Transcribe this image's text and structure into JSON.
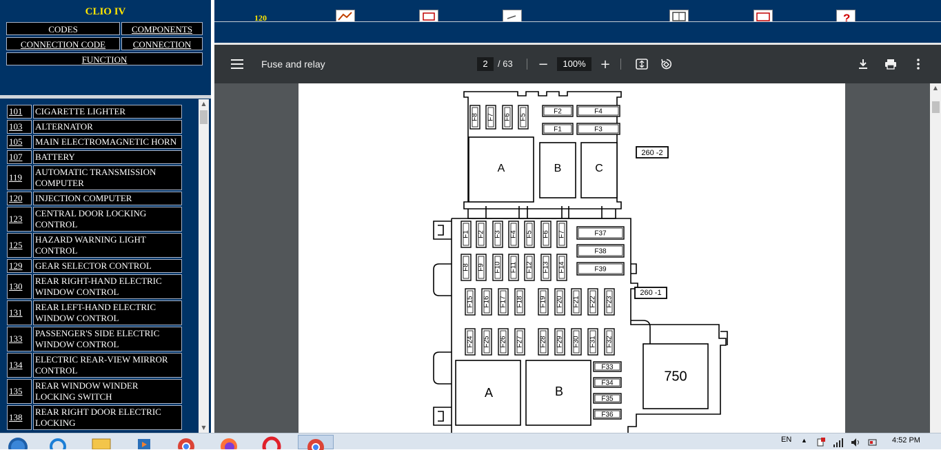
{
  "left_nav": {
    "title": "CLIO IV",
    "codes": "CODES",
    "components": "COMPONENTS",
    "connection_code": "CONNECTION CODE",
    "connection": "CONNECTION",
    "function": "FUNCTION"
  },
  "components_list": [
    {
      "num": "101",
      "name": "CIGARETTE LIGHTER"
    },
    {
      "num": "103",
      "name": "ALTERNATOR"
    },
    {
      "num": "105",
      "name": "MAIN ELECTROMAGNETIC HORN"
    },
    {
      "num": "107",
      "name": "BATTERY"
    },
    {
      "num": "119",
      "name": "AUTOMATIC TRANSMISSION COMPUTER"
    },
    {
      "num": "120",
      "name": "INJECTION COMPUTER"
    },
    {
      "num": "123",
      "name": "CENTRAL DOOR LOCKING CONTROL"
    },
    {
      "num": "125",
      "name": "HAZARD WARNING LIGHT CONTROL"
    },
    {
      "num": "129",
      "name": "GEAR SELECTOR CONTROL"
    },
    {
      "num": "130",
      "name": "REAR RIGHT-HAND ELECTRIC WINDOW CONTROL"
    },
    {
      "num": "131",
      "name": "REAR LEFT-HAND ELECTRIC WINDOW CONTROL"
    },
    {
      "num": "133",
      "name": "PASSENGER'S SIDE ELECTRIC WINDOW CONTROL"
    },
    {
      "num": "134",
      "name": "ELECTRIC REAR-VIEW MIRROR CONTROL"
    },
    {
      "num": "135",
      "name": "REAR WINDOW WINDER LOCKING SWITCH"
    },
    {
      "num": "138",
      "name": "REAR RIGHT DOOR ELECTRIC LOCKING"
    }
  ],
  "top_strip": {
    "partial_code": "120"
  },
  "pdf_toolbar": {
    "title": "Fuse and relay",
    "page_current": "2",
    "page_total": "/ 63",
    "zoom": "100%"
  },
  "diagram": {
    "upper_small_fuses": [
      "F8",
      "F7",
      "F6",
      "F5"
    ],
    "upper_wide_fuses": [
      "F2",
      "F4",
      "F1",
      "F3"
    ],
    "upper_relays": [
      "A",
      "B",
      "C"
    ],
    "label_top": "260 -2",
    "label_mid": "260 -1",
    "row1_fuses": [
      "F1",
      "F2",
      "F3",
      "F4",
      "F5",
      "F6",
      "F7"
    ],
    "row2_fuses": [
      "F8",
      "F9",
      "F10",
      "F11",
      "F12",
      "F13",
      "F14"
    ],
    "side_fuses": [
      "F37",
      "F38",
      "F39"
    ],
    "row3_fuses": [
      "F15",
      "F16",
      "F17",
      "F18",
      "F19",
      "F20",
      "F21",
      "F22",
      "F23"
    ],
    "row4_fuses": [
      "F24",
      "F25",
      "F26",
      "F27",
      "F28",
      "F29",
      "F30",
      "F31",
      "F32"
    ],
    "bottom_side_fuses": [
      "F33",
      "F34",
      "F35",
      "F36"
    ],
    "lower_relays": [
      "A",
      "B"
    ],
    "box_750": "750"
  },
  "taskbar": {
    "lang": "EN",
    "time": "4:52 PM"
  }
}
